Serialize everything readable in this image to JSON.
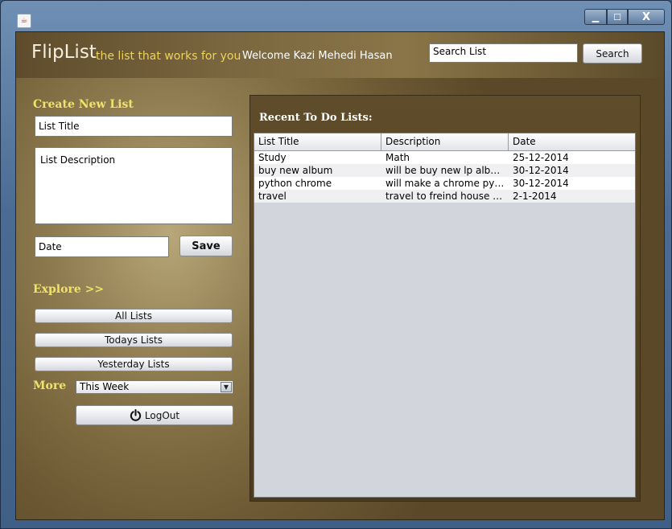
{
  "window": {
    "controls": {
      "minimize": "▁",
      "maximize": "☐",
      "close": "X"
    }
  },
  "header": {
    "brand": "FlipList",
    "tagline": "the list that works for you",
    "welcome": "Welcome Kazi Mehedi Hasan",
    "search_value": "Search List",
    "search_button": "Search"
  },
  "create": {
    "heading": "Create New List",
    "title_value": "List Title",
    "description_value": "List Description",
    "date_value": "Date",
    "save_label": "Save"
  },
  "explore": {
    "heading": "Explore >>",
    "all_lists": "All Lists",
    "todays_lists": "Todays Lists",
    "yesterday_lists": "Yesterday Lists"
  },
  "more": {
    "label": "More",
    "selected": "This Week"
  },
  "logout": {
    "label": "LogOut"
  },
  "recent": {
    "heading": "Recent To Do Lists:",
    "columns": [
      "List Title",
      "Description",
      "Date"
    ],
    "rows": [
      [
        "Study",
        "Math",
        "25-12-2014"
      ],
      [
        "buy new album",
        "will be buy new lp album ...",
        "30-12-2014"
      ],
      [
        "python chrome",
        "will make a chrome pytho...",
        "30-12-2014"
      ],
      [
        "travel",
        "travel to freind house @n...",
        "2-1-2014"
      ]
    ]
  },
  "colors": {
    "accent_yellow": "#f0e36a",
    "tagline_yellow": "#ecd35a",
    "titlebar_blue": "#4a6c94"
  }
}
